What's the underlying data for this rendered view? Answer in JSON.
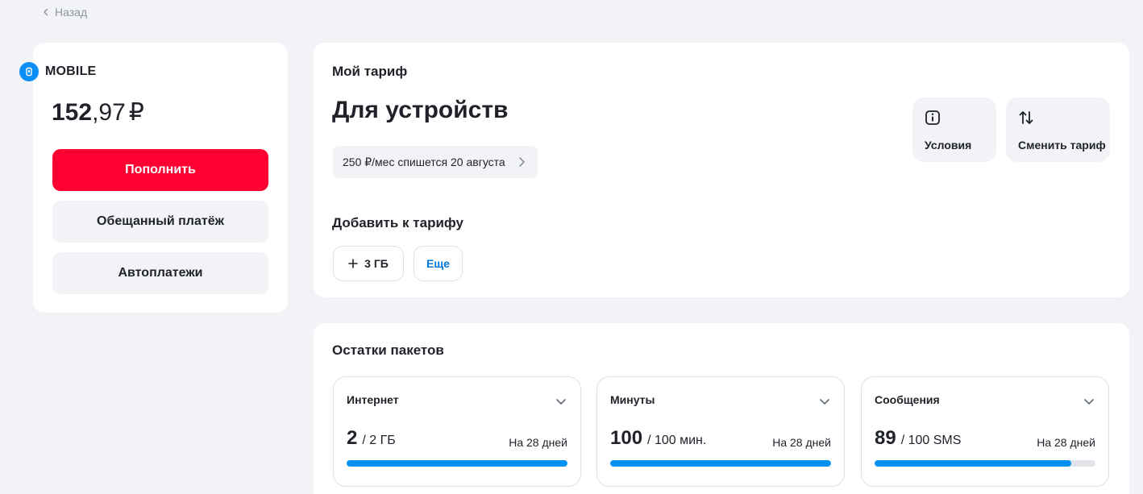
{
  "nav": {
    "back_label": "Назад"
  },
  "account": {
    "brand": "MOBILE",
    "balance_int": "152",
    "balance_frac": ",97",
    "currency": "₽",
    "topup_label": "Пополнить",
    "promised_payment_label": "Обещанный платёж",
    "autopay_label": "Автоплатежи"
  },
  "tariff": {
    "section_title": "Мой тариф",
    "name": "Для устройств",
    "charge_text": "250 ₽/мес спишется 20 августа",
    "conditions_label": "Условия",
    "change_label": "Сменить тариф",
    "add_title": "Добавить к тарифу",
    "addon_label": "3 ГБ",
    "more_label": "Еще"
  },
  "packages": {
    "title": "Остатки пакетов",
    "items": [
      {
        "title": "Интернет",
        "left": "2",
        "total": "/ 2 ГБ",
        "period": "На 28 дней",
        "fraction": 1.0
      },
      {
        "title": "Минуты",
        "left": "100",
        "total": "/ 100 мин.",
        "period": "На 28 дней",
        "fraction": 1.0
      },
      {
        "title": "Сообщения",
        "left": "89",
        "total": "/ 100 SMS",
        "period": "На 28 дней",
        "fraction": 0.89
      }
    ]
  },
  "colors": {
    "accent_red": "#ff0032",
    "progress_blue": "#0091f2",
    "link_blue": "#0077db",
    "background": "#f2f3f7"
  }
}
